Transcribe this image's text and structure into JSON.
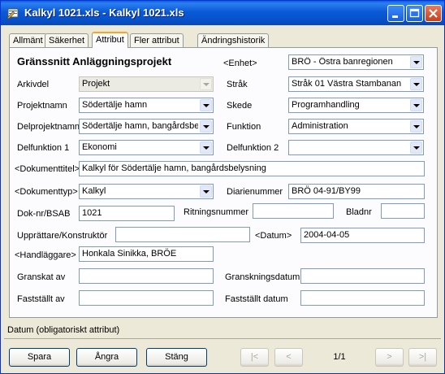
{
  "window": {
    "title": "Kalkyl 1021.xls - Kalkyl 1021.xls"
  },
  "tabs": [
    "Allmänt",
    "Säkerhet",
    "Attribut",
    "Fler attribut",
    "Ändringshistorik"
  ],
  "form": {
    "heading": "Gränssnitt Anläggningsprojekt",
    "labels": {
      "enhet": "<Enhet>",
      "arkivdel": "Arkivdel",
      "strak": "Stråk",
      "projektnamn": "Projektnamn",
      "skede": "Skede",
      "delprojektnamn": "Delprojektnamn",
      "funktion": "Funktion",
      "delfunktion1": "Delfunktion 1",
      "delfunktion2": "Delfunktion 2",
      "dokumenttitel": "<Dokumenttitel>",
      "dokumenttyp": "<Dokumenttyp>",
      "diarienummer": "Diarienummer",
      "doknr": "Dok-nr/BSAB",
      "ritningsnummer": "Ritningsnummer",
      "bladnr": "Bladnr",
      "upprattare": "Upprättare/Konstruktör",
      "datum": "<Datum>",
      "handlaggare": "<Handläggare>",
      "granskat": "Granskat av",
      "granskningsdatum": "Granskningsdatum",
      "faststallt_av": "Fastställt av",
      "faststallt_datum": "Fastställt datum"
    },
    "values": {
      "enhet": "BRÖ - Östra banregionen",
      "arkivdel": "Projekt",
      "strak": "Stråk 01 Västra Stambanan",
      "projektnamn": "Södertälje hamn",
      "skede": "Programhandling",
      "delprojektnamn": "Södertälje hamn, bangårdsbelysning",
      "funktion": "Administration",
      "delfunktion1": "Ekonomi",
      "delfunktion2": "",
      "dokumenttitel": "Kalkyl för Södertälje hamn, bangårdsbelysning",
      "dokumenttyp": "Kalkyl",
      "diarienummer": "BRÖ 04-91/BY99",
      "doknr": "1021",
      "ritningsnummer": "",
      "bladnr": "",
      "upprattare": "",
      "datum": "2004-04-05",
      "handlaggare": "Honkala Sinikka, BRÖE",
      "granskat": "",
      "granskningsdatum": "",
      "faststallt_av": "",
      "faststallt_datum": ""
    }
  },
  "status": {
    "text": "Datum (obligatoriskt attribut)"
  },
  "buttons": {
    "save": "Spara",
    "undo": "Ångra",
    "close": "Stäng",
    "first": "|<",
    "prev": "<",
    "next": ">",
    "last": ">|"
  },
  "pager": {
    "text": "1/1"
  },
  "colors": {
    "title_blue": "#0a5ad6",
    "accent_tab": "#f5a623"
  },
  "icons": [
    "app-icon",
    "minimize-icon",
    "maximize-icon",
    "close-icon",
    "dropdown-arrow-icon"
  ]
}
